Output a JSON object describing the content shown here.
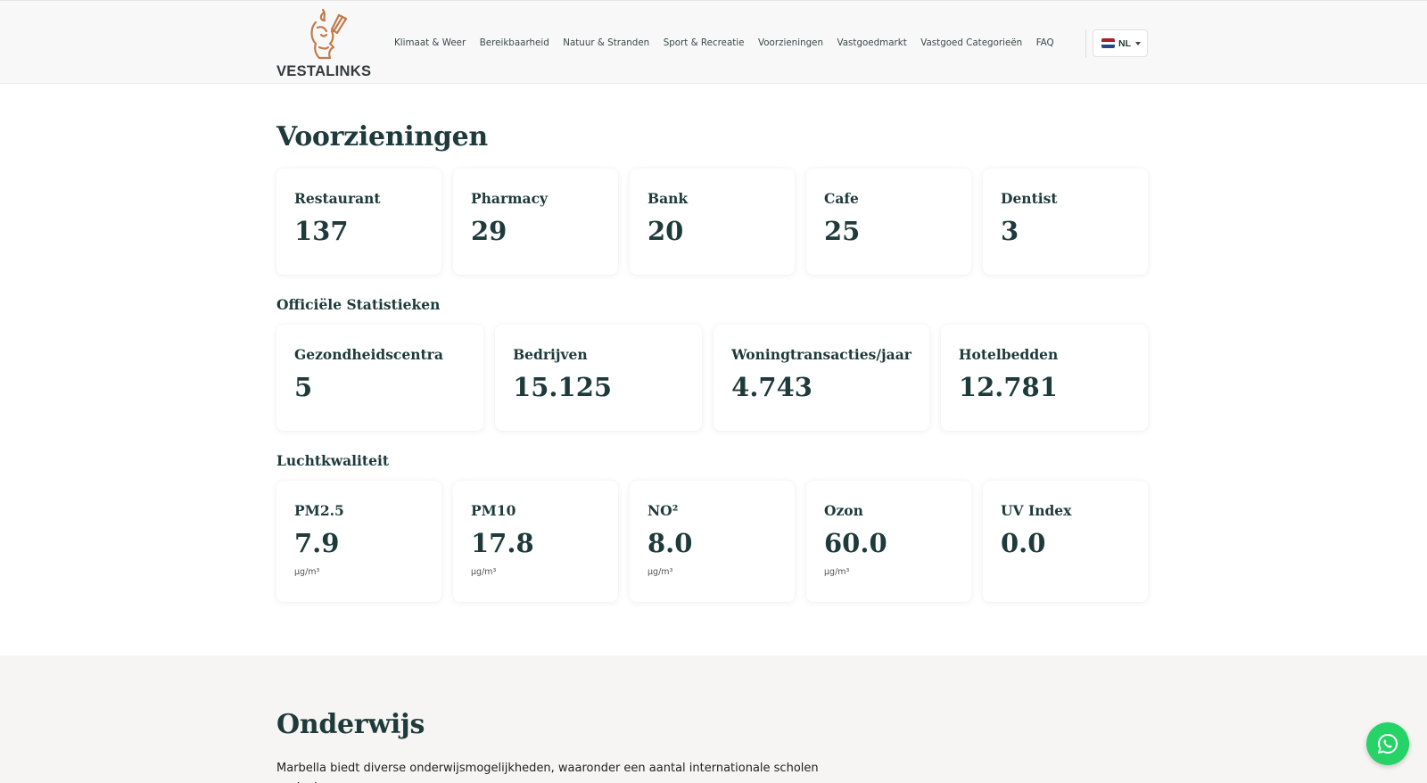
{
  "header": {
    "logo_text": "VESTALINKS",
    "nav": [
      "Klimaat & Weer",
      "Bereikbaarheid",
      "Natuur & Stranden",
      "Sport & Recreatie",
      "Voorzieningen",
      "Vastgoedmarkt",
      "Vastgoed Categorieën",
      "FAQ"
    ],
    "language": "NL"
  },
  "voorzieningen": {
    "title": "Voorzieningen",
    "cards": [
      {
        "label": "Restaurant",
        "value": "137"
      },
      {
        "label": "Pharmacy",
        "value": "29"
      },
      {
        "label": "Bank",
        "value": "20"
      },
      {
        "label": "Cafe",
        "value": "25"
      },
      {
        "label": "Dentist",
        "value": "3"
      }
    ]
  },
  "statistieken": {
    "title": "Officiële Statistieken",
    "cards": [
      {
        "label": "Gezondheidscentra",
        "value": "5"
      },
      {
        "label": "Bedrijven",
        "value": "15.125"
      },
      {
        "label": "Woningtransacties/jaar",
        "value": "4.743"
      },
      {
        "label": "Hotelbedden",
        "value": "12.781"
      }
    ]
  },
  "luchtkwaliteit": {
    "title": "Luchtkwaliteit",
    "cards": [
      {
        "label": "PM2.5",
        "value": "7.9",
        "unit": "µg/m³"
      },
      {
        "label": "PM10",
        "value": "17.8",
        "unit": "µg/m³"
      },
      {
        "label": "NO²",
        "value": "8.0",
        "unit": "µg/m³"
      },
      {
        "label": "Ozon",
        "value": "60.0",
        "unit": "µg/m³"
      },
      {
        "label": "UV Index",
        "value": "0.0",
        "unit": ""
      }
    ]
  },
  "onderwijs": {
    "title": "Onderwijs",
    "text": "Marbella biedt diverse onderwijsmogelijkheden, waaronder een aantal internationale scholen zoals de"
  },
  "icons": {
    "logo": "vesta-torch-head-icon",
    "whatsapp": "whatsapp-icon"
  },
  "colors": {
    "accent": "#c27a4a",
    "heading": "#1e3a3a",
    "whatsapp": "#25d366"
  }
}
